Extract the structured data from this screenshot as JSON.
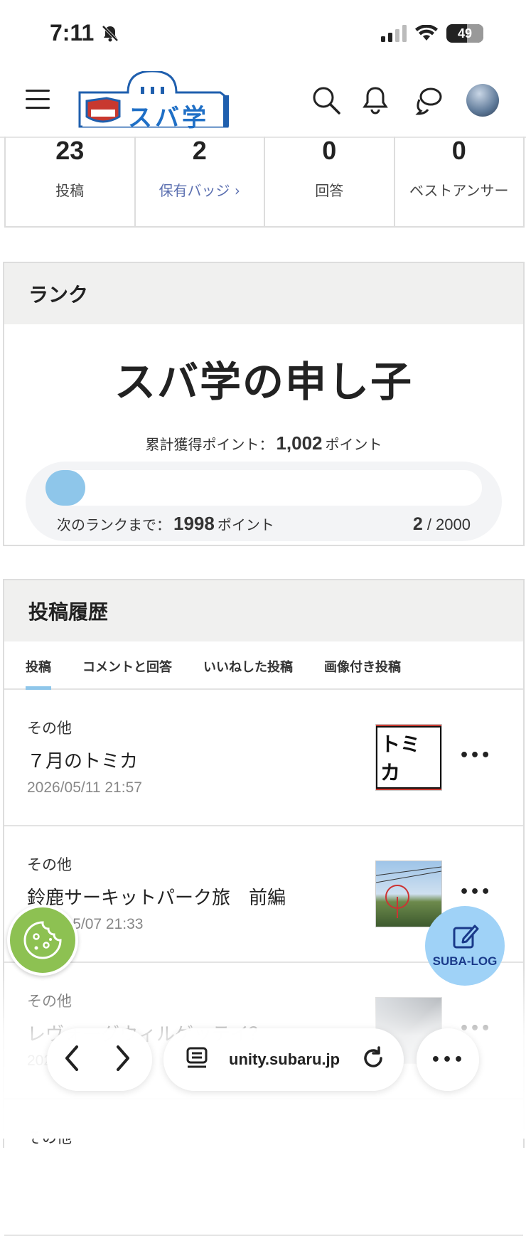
{
  "status_bar": {
    "time": "7:11",
    "battery": "49"
  },
  "header": {
    "logo_text": "スバ学"
  },
  "stats": [
    {
      "value": "23",
      "label": "投稿"
    },
    {
      "value": "2",
      "label": "保有バッジ ›"
    },
    {
      "value": "0",
      "label": "回答"
    },
    {
      "value": "0",
      "label": "ベストアンサー"
    }
  ],
  "rank": {
    "heading": "ランク",
    "title": "スバ学の申し子",
    "total_label": "累計獲得ポイント：",
    "total_value": "1,002",
    "points_unit": "ポイント",
    "next_label": "次のランクまで：",
    "next_value": "1998",
    "progress_current": "2",
    "progress_sep": " / 2000",
    "progress_fraction": 0.001
  },
  "history": {
    "heading": "投稿履歴",
    "tabs": [
      "投稿",
      "コメントと回答",
      "いいねした投稿",
      "画像付き投稿"
    ],
    "posts": [
      {
        "category": "その他",
        "title": "７月のトミカ",
        "date": "2026/05/11 21:57",
        "thumb_text": "トミカ"
      },
      {
        "category": "その他",
        "title": "鈴鹿サーキットパーク旅　前編",
        "date": "2026/05/07 21:33"
      },
      {
        "category": "その他",
        "title": "レヴォーグウィルゲッテイ？",
        "date": "2026/05/03 10:12"
      },
      {
        "category": "その他"
      }
    ],
    "more_icon": "•••"
  },
  "fab": {
    "label": "SUBA-LOG"
  },
  "browser": {
    "url": "unity.subaru.jp",
    "more_icon": "•••"
  }
}
